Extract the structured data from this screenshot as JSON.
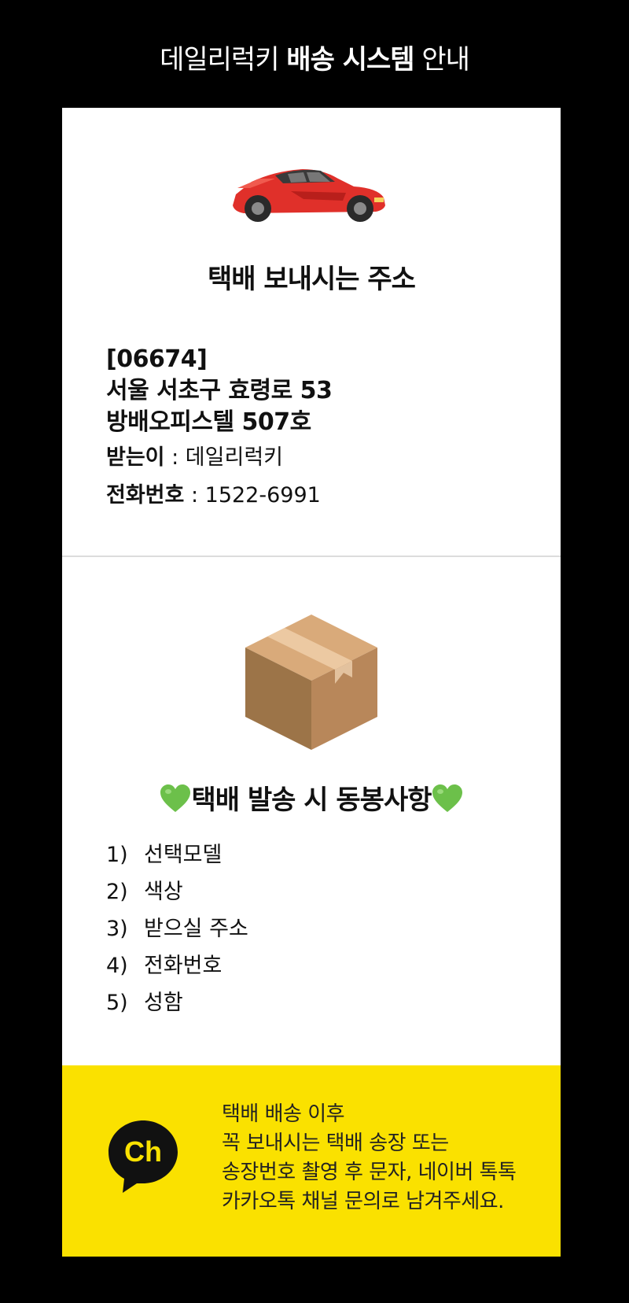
{
  "header": {
    "title_prefix": "데일리럭키 ",
    "title_bold": "배송 시스템",
    "title_suffix": " 안내"
  },
  "address_section": {
    "icon": "red-car-icon",
    "title": "택배 보내시는 주소",
    "postal_code": "[06674]",
    "address_line1": "서울 서초구 효령로 53",
    "address_line2": "방배오피스텔 507호",
    "recipient_label": "받는이",
    "recipient_value": " : 데일리럭키",
    "phone_label": "전화번호",
    "phone_value": " : 1522-6991"
  },
  "enclosure_section": {
    "icon": "cardboard-box-icon",
    "decoration_icon": "green-heart-icon",
    "title": "택배 발송 시 동봉사항",
    "items": [
      {
        "num": "1)",
        "text": "선택모델"
      },
      {
        "num": "2)",
        "text": "색상"
      },
      {
        "num": "3)",
        "text": "받으실 주소"
      },
      {
        "num": "4)",
        "text": "전화번호"
      },
      {
        "num": "5)",
        "text": "성함"
      }
    ]
  },
  "notice": {
    "icon": "kakao-channel-icon",
    "icon_label": "Ch",
    "lines": [
      "택배 배송 이후",
      "꼭 보내시는 택배 송장 또는",
      "송장번호 촬영 후 문자, 네이버 톡톡",
      "카카오톡 채널 문의로 남겨주세요."
    ]
  },
  "colors": {
    "background": "#000000",
    "card": "#ffffff",
    "notice_bg": "#fae100",
    "heart": "#6cc04a",
    "car": "#e0302a",
    "box": "#c69a6d"
  }
}
